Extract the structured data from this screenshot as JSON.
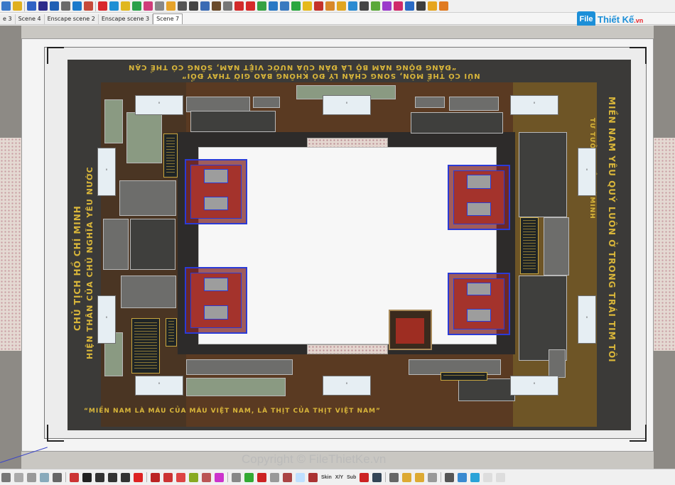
{
  "scene_tabs": [
    {
      "label": "e 3",
      "active": false
    },
    {
      "label": "Scene 4",
      "active": false
    },
    {
      "label": "Enscape scene 2",
      "active": false
    },
    {
      "label": "Enscape scene 3",
      "active": false
    },
    {
      "label": "Scene 7",
      "active": true
    }
  ],
  "logo": {
    "mark": "File",
    "name": "Thiết Kế",
    "domain": ".vn"
  },
  "viewport": {
    "label_boxes": [
      {
        "text": "'"
      },
      {
        "text": "'"
      },
      {
        "text": "'"
      },
      {
        "text": "'"
      },
      {
        "text": "'"
      },
      {
        "text": "'"
      },
      {
        "text": "'"
      },
      {
        "text": "'"
      },
      {
        "text": "'"
      },
      {
        "text": "'"
      }
    ],
    "slogans": {
      "top": "“ĐẢNG ĐỘNG NAM BỘ LÀ ĐÀN CỦA NƯỚC VIỆT NAM, SÔNG CÓ THỂ CẠN",
      "top2": "NÚI CÓ THỂ MÒN, SONG CHÂN LÝ ĐÓ KHÔNG BAO GIỜ THAY ĐỔI”",
      "left1": "CHỦ TỊCH HỒ CHÍ MINH",
      "left2": "HIỆN THÂN CỦA CHỦ NGHĨA YÊU NƯỚC",
      "right1": "MIỀN NAM YÊU QUÝ LUÔN Ở TRONG TRÁI TIM TÔI",
      "right2": "TƯ TƯỞNG HỒ CHÍ MINH",
      "bottom": "“MIỀN NAM LÀ MÁU CỦA MÁU VIỆT NAM, LÀ THỊT CỦA THỊT VIỆT NAM”"
    }
  },
  "watermark": "Copyright © FileThietKe.vn",
  "bottom_labels": {
    "skin": "Skin",
    "xyz": "X/Y",
    "sub": "Sub"
  }
}
